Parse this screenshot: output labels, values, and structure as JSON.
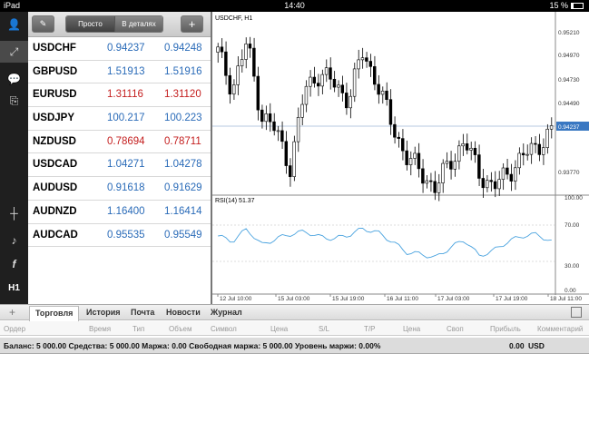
{
  "status_bar": {
    "device": "iPad",
    "time": "14:40",
    "battery": "15 %"
  },
  "sidebar": {
    "items": [
      {
        "name": "account-icon",
        "glyph": "👤"
      },
      {
        "name": "trade-arrows-icon",
        "glyph": "⤢"
      },
      {
        "name": "chat-icon",
        "glyph": "💬"
      },
      {
        "name": "new-order-icon",
        "glyph": "⎘"
      },
      {
        "name": "crosshair-icon",
        "glyph": "┼"
      },
      {
        "name": "objects-icon",
        "glyph": "♪"
      },
      {
        "name": "indicators-icon",
        "glyph": "f"
      },
      {
        "name": "timeframe",
        "glyph": "H1"
      }
    ]
  },
  "quotes_toolbar": {
    "simple_label": "Просто",
    "detailed_label": "В деталях",
    "edit_glyph": "✎",
    "add_glyph": "+"
  },
  "quotes": [
    {
      "symbol": "USDCHF",
      "bid": "0.94237",
      "ask": "0.94248",
      "color": "blue"
    },
    {
      "symbol": "GBPUSD",
      "bid": "1.51913",
      "ask": "1.51916",
      "color": "blue"
    },
    {
      "symbol": "EURUSD",
      "bid": "1.31116",
      "ask": "1.31120",
      "color": "red"
    },
    {
      "symbol": "USDJPY",
      "bid": "100.217",
      "ask": "100.223",
      "color": "blue"
    },
    {
      "symbol": "NZDUSD",
      "bid": "0.78694",
      "ask": "0.78711",
      "color": "red"
    },
    {
      "symbol": "USDCAD",
      "bid": "1.04271",
      "ask": "1.04278",
      "color": "blue"
    },
    {
      "symbol": "AUDUSD",
      "bid": "0.91618",
      "ask": "0.91629",
      "color": "blue"
    },
    {
      "symbol": "AUDNZD",
      "bid": "1.16400",
      "ask": "1.16414",
      "color": "blue"
    },
    {
      "symbol": "AUDCAD",
      "bid": "0.95535",
      "ask": "0.95549",
      "color": "blue"
    }
  ],
  "chart": {
    "title": "USDCHF, H1",
    "price_labels": [
      "0.95210",
      "0.94970",
      "0.94730",
      "0.94490",
      "0.94237",
      "0.93770"
    ],
    "current_price": "0.94237",
    "rsi_title": "RSI(14) 51.37",
    "rsi_labels": [
      "100.00",
      "70.00",
      "30.00",
      "0.00"
    ],
    "time_labels": [
      "12 Jul 10:00",
      "15 Jul 03:00",
      "15 Jul 19:00",
      "16 Jul 11:00",
      "17 Jul 03:00",
      "17 Jul 19:00",
      "18 Jul 11:00"
    ],
    "up_color": "#ffffff",
    "down_color": "#000000",
    "rsi_color": "#4aa3df"
  },
  "chart_data": {
    "type": "candlestick",
    "title": "USDCHF, H1",
    "x": [
      "12 Jul 10:00",
      "15 Jul 03:00",
      "15 Jul 19:00",
      "16 Jul 11:00",
      "17 Jul 03:00",
      "17 Jul 19:00",
      "18 Jul 11:00"
    ],
    "close": [
      0.95,
      0.9465,
      0.951,
      0.944,
      0.9425,
      0.939,
      0.9465,
      0.948,
      0.947,
      0.9455,
      0.95,
      0.947,
      0.943,
      0.94,
      0.9385,
      0.937,
      0.9395,
      0.9415,
      0.9385,
      0.937,
      0.9385,
      0.94,
      0.941,
      0.9424
    ],
    "ylim": [
      0.9365,
      0.953
    ],
    "rsi": {
      "name": "RSI(14)",
      "last": 51.37,
      "levels": [
        30,
        70
      ],
      "ylim": [
        0,
        100
      ],
      "values": [
        58,
        52,
        66,
        48,
        55,
        60,
        63,
        57,
        55,
        59,
        66,
        62,
        52,
        40,
        38,
        34,
        45,
        54,
        36,
        42,
        52,
        58,
        60,
        51.37
      ]
    }
  },
  "tabs": [
    {
      "label": "Торговля",
      "active": true
    },
    {
      "label": "История",
      "active": false
    },
    {
      "label": "Почта",
      "active": false
    },
    {
      "label": "Новости",
      "active": false
    },
    {
      "label": "Журнал",
      "active": false
    }
  ],
  "columns": [
    "Ордер",
    "Время",
    "Тип",
    "Объем",
    "Символ",
    "Цена",
    "S/L",
    "T/P",
    "Цена",
    "Своп",
    "Прибыль",
    "Комментарий"
  ],
  "balance": {
    "text": "Баланс: 5 000.00 Средства: 5 000.00 Маржа: 0.00 Свободная маржа: 5 000.00 Уровень маржи: 0.00%",
    "amount": "0.00",
    "currency": "USD"
  }
}
